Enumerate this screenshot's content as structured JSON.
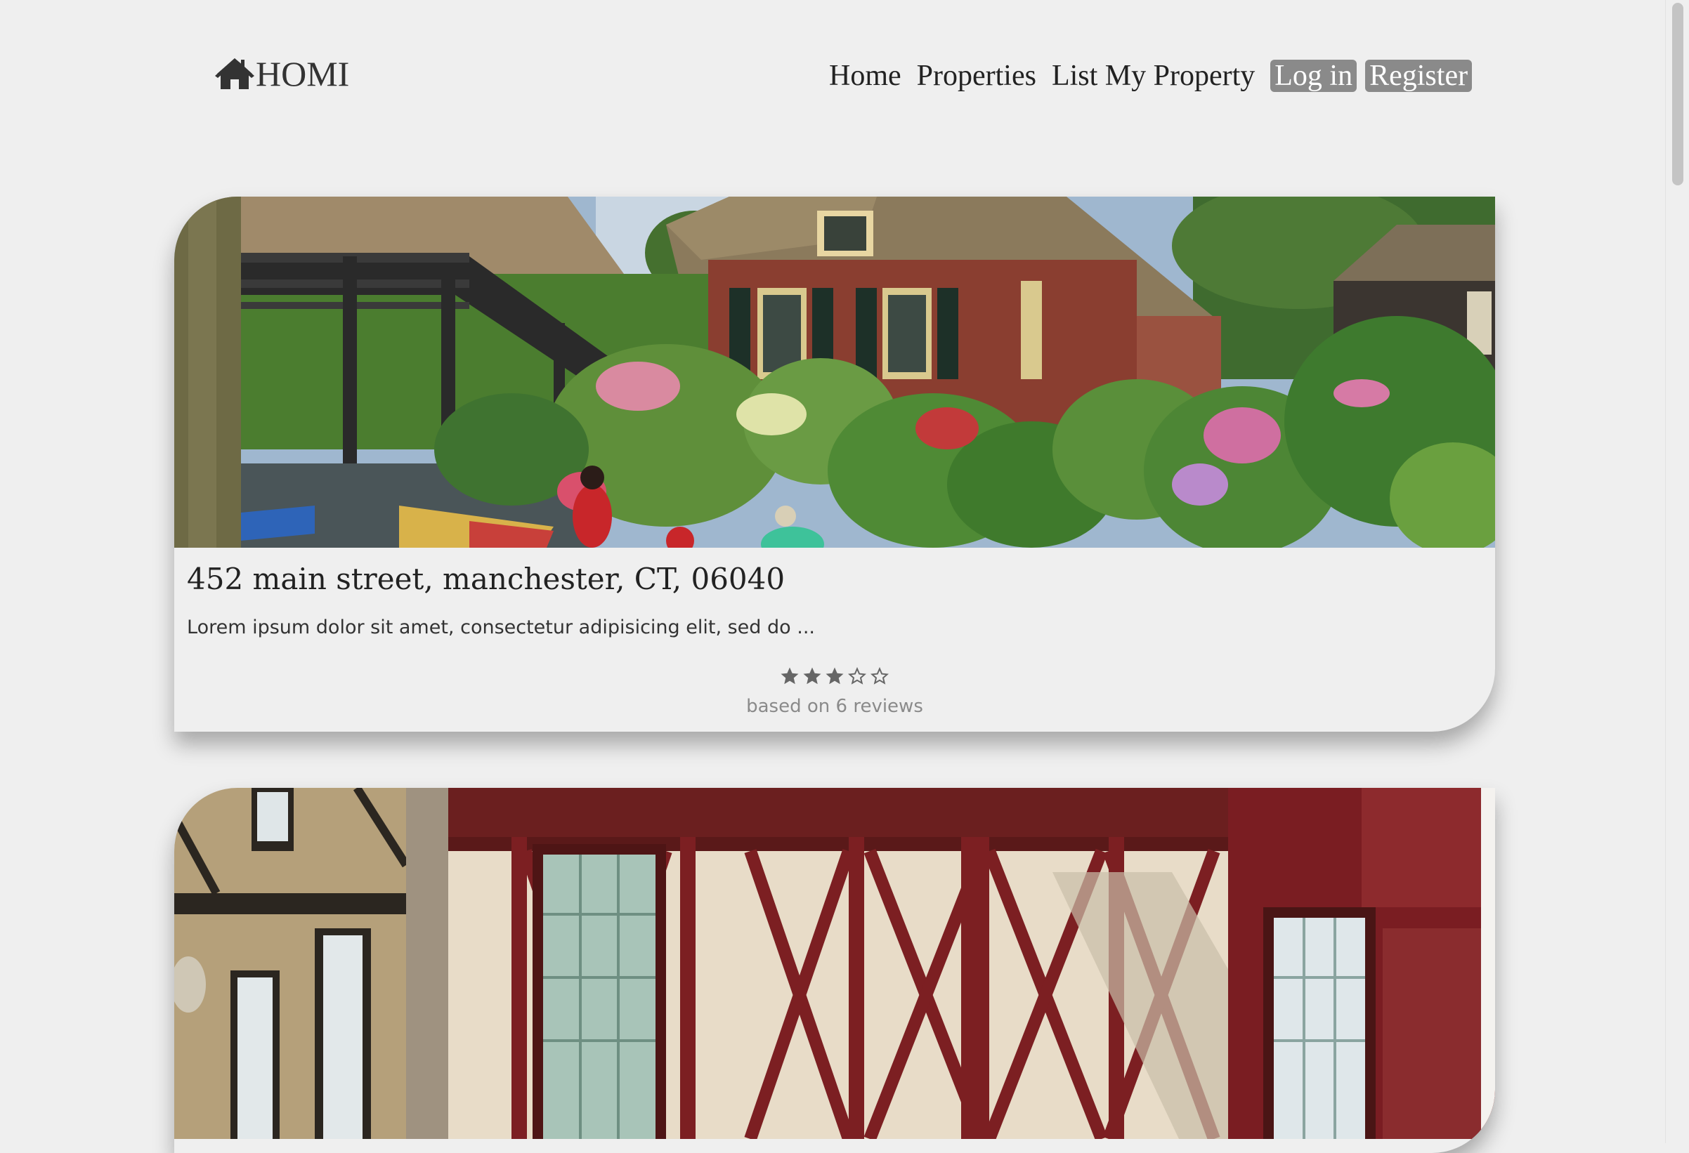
{
  "header": {
    "logo_text": "HOMI",
    "logo_icon": "home-icon",
    "nav": {
      "home": "Home",
      "properties": "Properties",
      "list_property": "List My Property",
      "login": "Log in",
      "register": "Register"
    },
    "button_color": "#8a8a8a"
  },
  "listings": [
    {
      "address": "452 main street, manchester, CT, 06040",
      "description": "Lorem ipsum dolor sit amet, consectetur adipisicing elit, sed do ...",
      "rating": 3,
      "rating_max": 5,
      "reviews_text": "based on 6 reviews",
      "photo": "thatched brick cottage with garden and canal bridge"
    },
    {
      "photo": "half-timbered house with red diagonal beams"
    }
  ],
  "colors": {
    "background": "#efefef",
    "star": "#666666",
    "muted_text": "#8a8a8a"
  }
}
